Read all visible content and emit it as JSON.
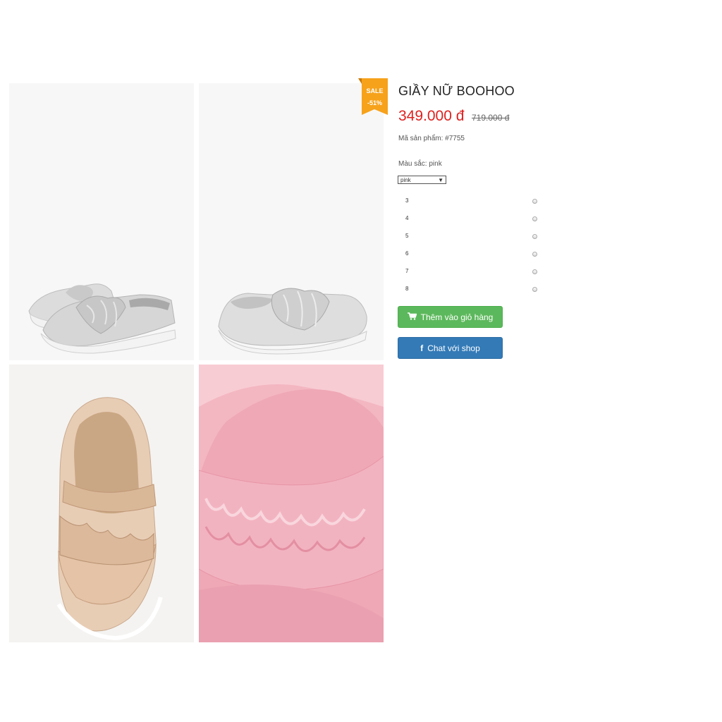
{
  "product": {
    "title": "GIẦY NỮ BOOHOO",
    "price": "349.000 đ",
    "old_price": "719.000 đ",
    "sku": "Mã sản phẩm: #7755",
    "color_label": "Màu sắc: pink",
    "color_selected": "pink"
  },
  "badge": {
    "sale": "SALE",
    "percent": "-51%",
    "color": "#f7a21b"
  },
  "sizes": [
    "3",
    "4",
    "5",
    "6",
    "7",
    "8"
  ],
  "buttons": {
    "add_to_cart": "Thêm vào giỏ hàng",
    "chat": "Chat với shop",
    "cart_icon": "shopping-cart-icon",
    "chat_icon": "facebook-icon"
  },
  "colors": {
    "price": "#e02020",
    "cart_button": "#5cb85c",
    "chat_button": "#337ab7"
  },
  "images": [
    {
      "name": "silver-shoes-pair"
    },
    {
      "name": "silver-shoe-side"
    },
    {
      "name": "gold-shoe-top"
    },
    {
      "name": "pink-shoe-closeup"
    }
  ]
}
